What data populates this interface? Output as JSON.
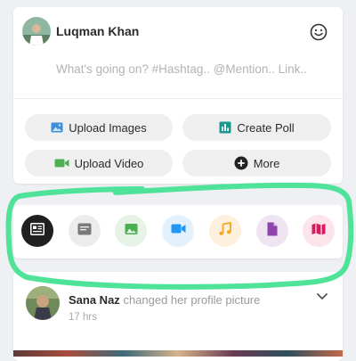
{
  "composer": {
    "user_name": "Luqman Khan",
    "placeholder": "What's going on? #Hashtag.. @Mention.. Link..",
    "actions": [
      {
        "label": "Upload Images",
        "icon": "image-icon"
      },
      {
        "label": "Create Poll",
        "icon": "poll-icon"
      },
      {
        "label": "Upload Video",
        "icon": "video-icon"
      },
      {
        "label": "More",
        "icon": "plus-circle-icon"
      }
    ],
    "emoji_icon": "smiley-icon"
  },
  "filter_bar": {
    "items": [
      {
        "name": "text-post-filter",
        "icon": "article-icon",
        "bg": "#202020",
        "fg": "#ffffff",
        "active": true
      },
      {
        "name": "status-filter",
        "icon": "message-icon",
        "bg": "#ececec",
        "fg": "#7a7a7a",
        "active": false
      },
      {
        "name": "photos-filter",
        "icon": "image-icon",
        "bg": "#e6f3e6",
        "fg": "#4caf50",
        "active": false
      },
      {
        "name": "videos-filter",
        "icon": "video-icon",
        "bg": "#e3f1fc",
        "fg": "#2196f3",
        "active": false
      },
      {
        "name": "music-filter",
        "icon": "music-note-icon",
        "bg": "#fdf0dc",
        "fg": "#f5a623",
        "active": false
      },
      {
        "name": "files-filter",
        "icon": "file-icon",
        "bg": "#efe4f1",
        "fg": "#8e44ad",
        "active": false
      },
      {
        "name": "maps-filter",
        "icon": "map-icon",
        "bg": "#fbe4ea",
        "fg": "#d81b60",
        "active": false
      }
    ]
  },
  "post": {
    "author": "Sana Naz",
    "action": "changed her profile picture",
    "time": "17 hrs"
  },
  "colors": {
    "highlight": "#4fe39a",
    "images_icon": "#3d8fd8",
    "poll_icon": "#1a9a8f",
    "video_icon": "#4caf50"
  }
}
